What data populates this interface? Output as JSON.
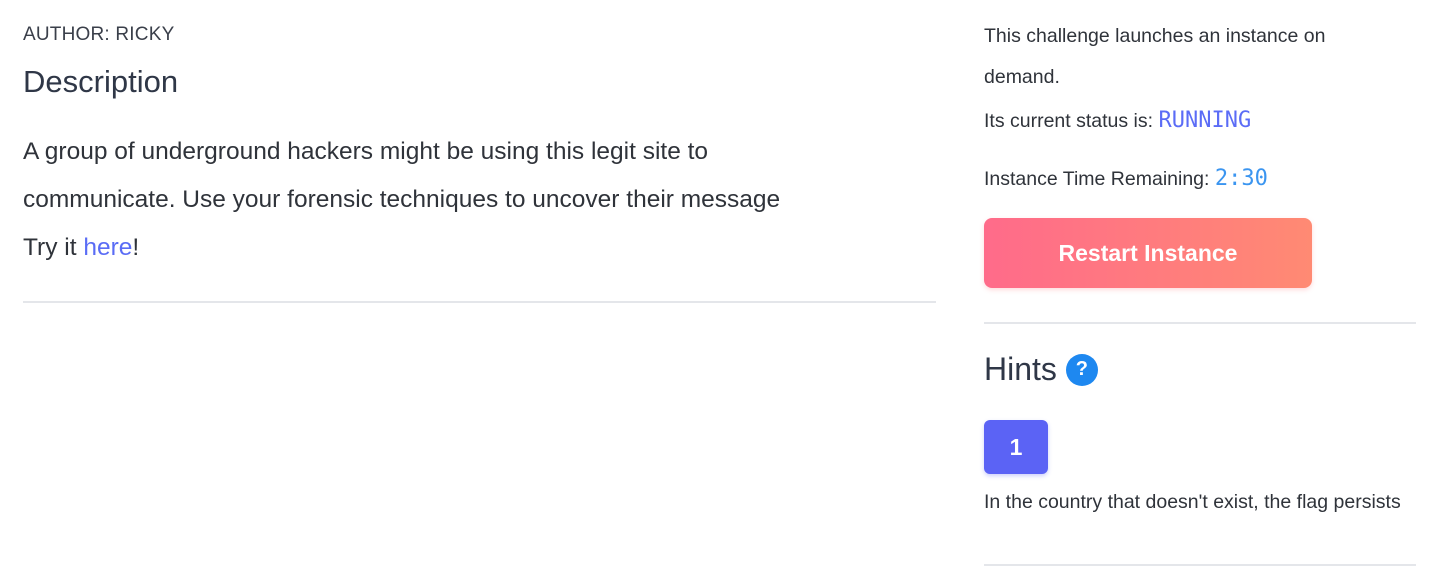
{
  "description_panel": {
    "author": "AUTHOR: RICKY",
    "title": "Description",
    "body_line_1": "A group of underground hackers might be using this legit site to",
    "body_line_2": "communicate. Use your forensic techniques to uncover their message",
    "try_prefix": "Try it ",
    "try_link": "here",
    "try_suffix": "!"
  },
  "instance_panel": {
    "launch_text": "This challenge launches an instance on demand.",
    "status_label": "Its current status is: ",
    "status_value": "RUNNING",
    "time_label": "Instance Time Remaining: ",
    "time_value": "2:30",
    "restart_button": "Restart Instance"
  },
  "hints_panel": {
    "title": "Hints",
    "help_icon": "?",
    "hint_buttons": [
      "1"
    ],
    "hint_text": "In the country that doesn't exist, the flag persists"
  },
  "colors": {
    "accent": "#5b63f5",
    "status": "#5b6cf6",
    "timer": "#3b95f0",
    "restart_gradient_start": "#ff6b8a",
    "restart_gradient_end": "#ff8a73",
    "help_icon": "#1e88f0"
  }
}
